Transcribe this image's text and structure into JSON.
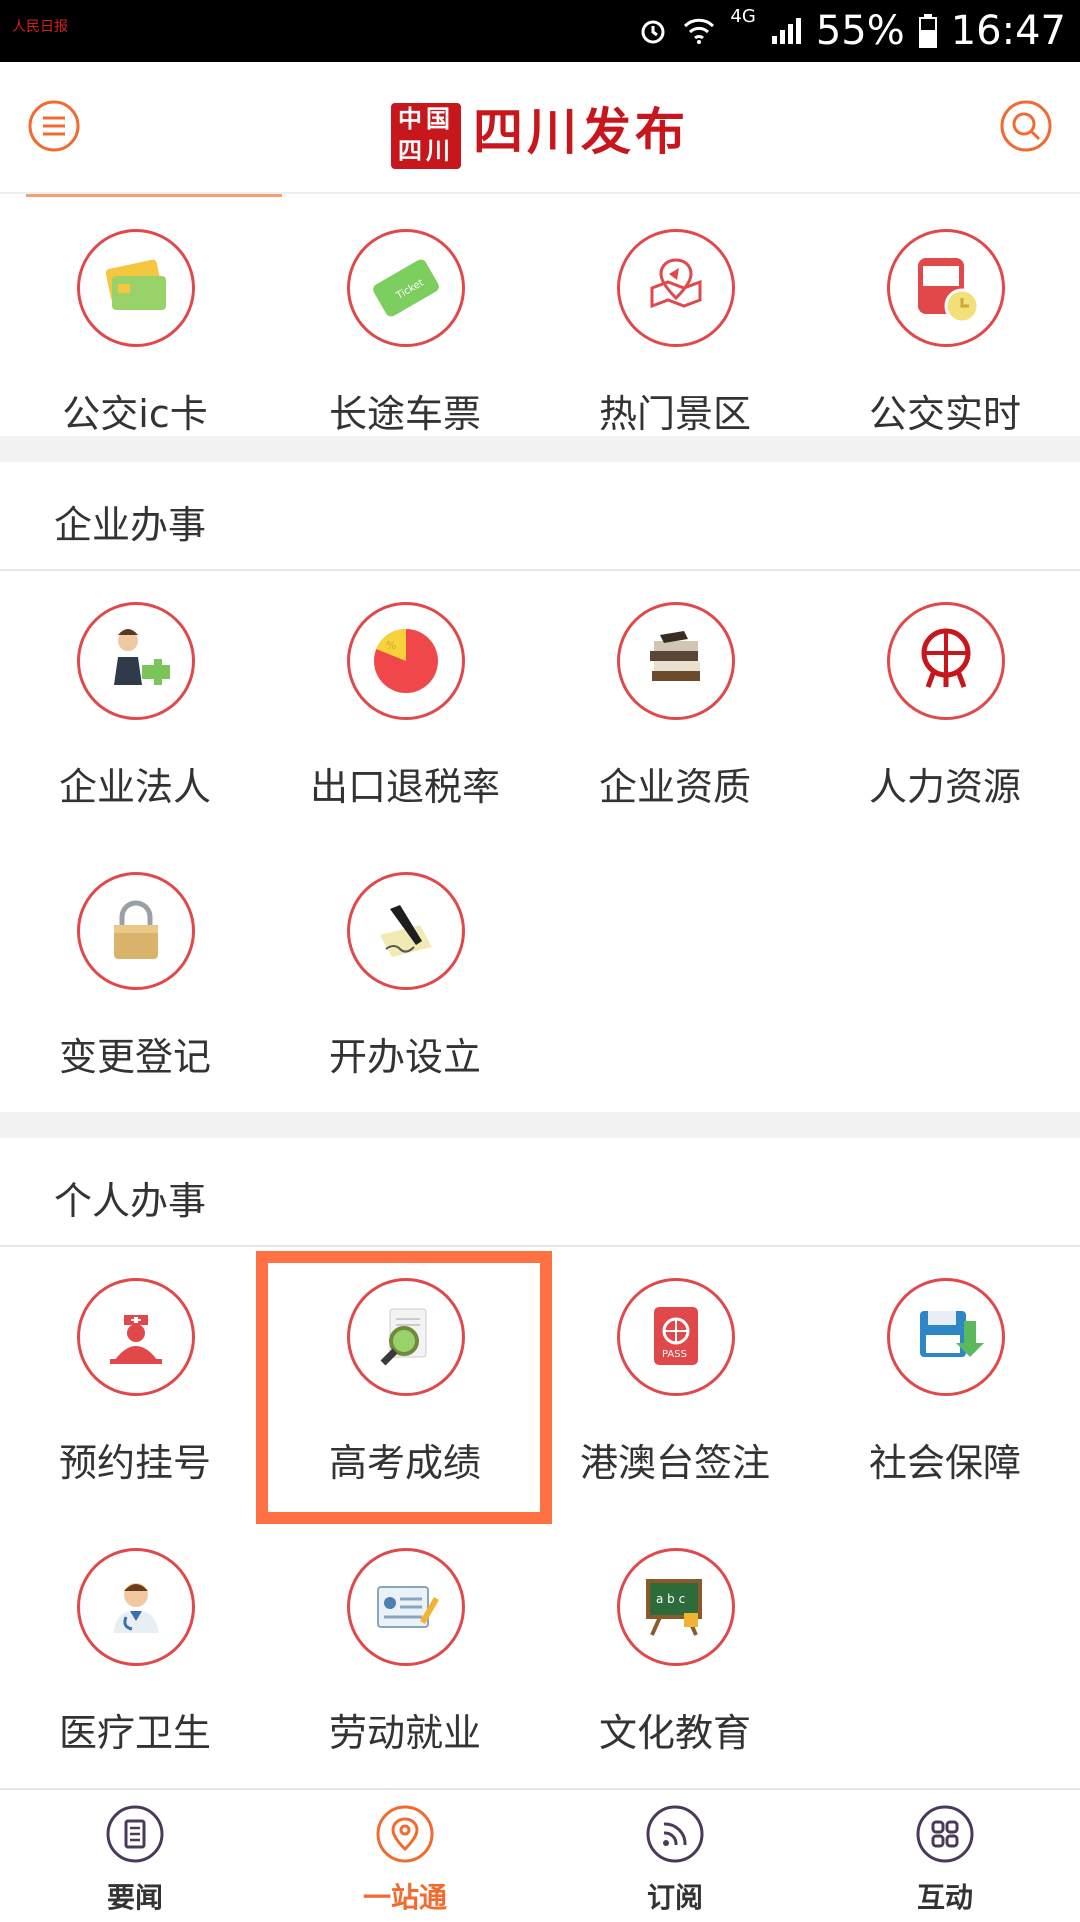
{
  "status_bar": {
    "app_logo_text": "人民日报",
    "network": "4G",
    "battery_percent": "55%",
    "time": "16:47",
    "icons": [
      "alarm-icon",
      "wifi-icon",
      "signal-icon",
      "battery-icon"
    ]
  },
  "header": {
    "title": "四川发布",
    "seal_text": "中国四川",
    "menu_icon": "menu-icon",
    "search_icon": "search-icon"
  },
  "colors": {
    "accent": "#f26a2e",
    "brand_red": "#c8161d",
    "ring": "#e0484a",
    "highlight": "#ff7043"
  },
  "top_items": [
    {
      "label": "公交ic卡",
      "icon": "transit-card-icon"
    },
    {
      "label": "长途车票",
      "icon": "ticket-icon"
    },
    {
      "label": "热门景区",
      "icon": "map-pin-icon"
    },
    {
      "label": "公交实时",
      "icon": "bus-clock-icon"
    }
  ],
  "sections": [
    {
      "title": "企业办事",
      "items": [
        {
          "label": "企业法人",
          "icon": "business-person-icon"
        },
        {
          "label": "出口退税率",
          "icon": "pie-chart-icon"
        },
        {
          "label": "企业资质",
          "icon": "books-icon"
        },
        {
          "label": "人力资源",
          "icon": "globe-person-icon"
        },
        {
          "label": "变更登记",
          "icon": "lock-icon"
        },
        {
          "label": "开办设立",
          "icon": "sign-document-icon"
        }
      ]
    },
    {
      "title": "个人办事",
      "items": [
        {
          "label": "预约挂号",
          "icon": "nurse-icon"
        },
        {
          "label": "高考成绩",
          "icon": "magnifier-document-icon"
        },
        {
          "label": "港澳台签注",
          "icon": "passport-icon"
        },
        {
          "label": "社会保障",
          "icon": "save-disk-icon"
        },
        {
          "label": "医疗卫生",
          "icon": "doctor-icon"
        },
        {
          "label": "劳动就业",
          "icon": "id-card-icon"
        },
        {
          "label": "文化教育",
          "icon": "chalkboard-icon"
        }
      ]
    }
  ],
  "bottom_nav": [
    {
      "label": "要闻",
      "icon": "news-icon",
      "active": false
    },
    {
      "label": "一站通",
      "icon": "location-pin-icon",
      "active": true
    },
    {
      "label": "订阅",
      "icon": "rss-icon",
      "active": false
    },
    {
      "label": "互动",
      "icon": "grid-icon",
      "active": false
    }
  ]
}
